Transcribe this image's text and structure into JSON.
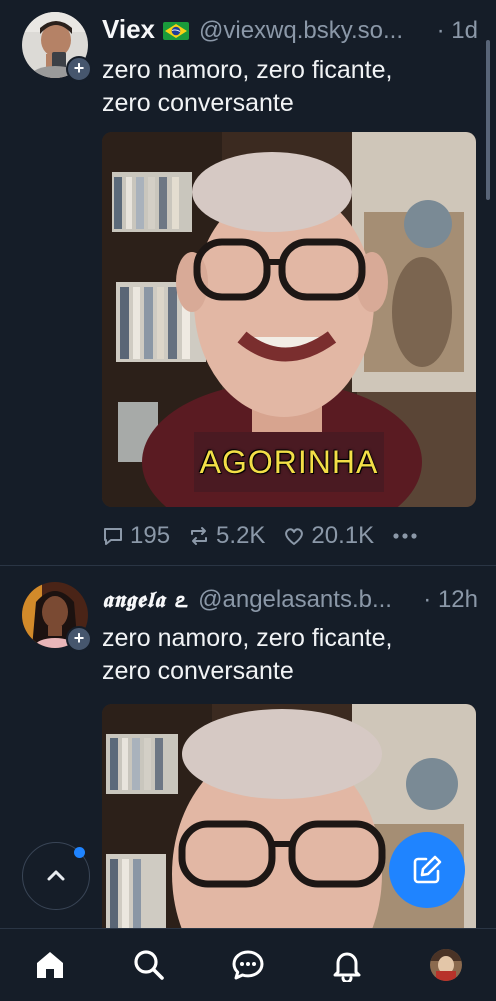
{
  "posts": [
    {
      "author": "Viex",
      "handle": "@viexwq.bsky.so...",
      "time": "· 1d",
      "text_line1": "zero namoro, zero ficante,",
      "text_line2": "zero conversante",
      "media_caption": "AGORINHA",
      "replies": "195",
      "reposts": "5.2K",
      "likes": "20.1K"
    },
    {
      "author": "𝖆𝖓𝖌𝖊𝖑𝖆 ఽ",
      "handle": "@angelasants.b...",
      "time": "· 12h",
      "text_line1": "zero namoro, zero ficante,",
      "text_line2": "zero conversante"
    }
  ],
  "colors": {
    "background": "#151d28",
    "accent": "#1f84ff",
    "muted": "#8b98a8"
  },
  "icons": [
    "plus-icon",
    "brazil-flag-icon",
    "reply-icon",
    "repost-icon",
    "like-icon",
    "more-icon",
    "chevron-up-icon",
    "compose-icon",
    "home-icon",
    "search-icon",
    "chat-icon",
    "bell-icon"
  ]
}
